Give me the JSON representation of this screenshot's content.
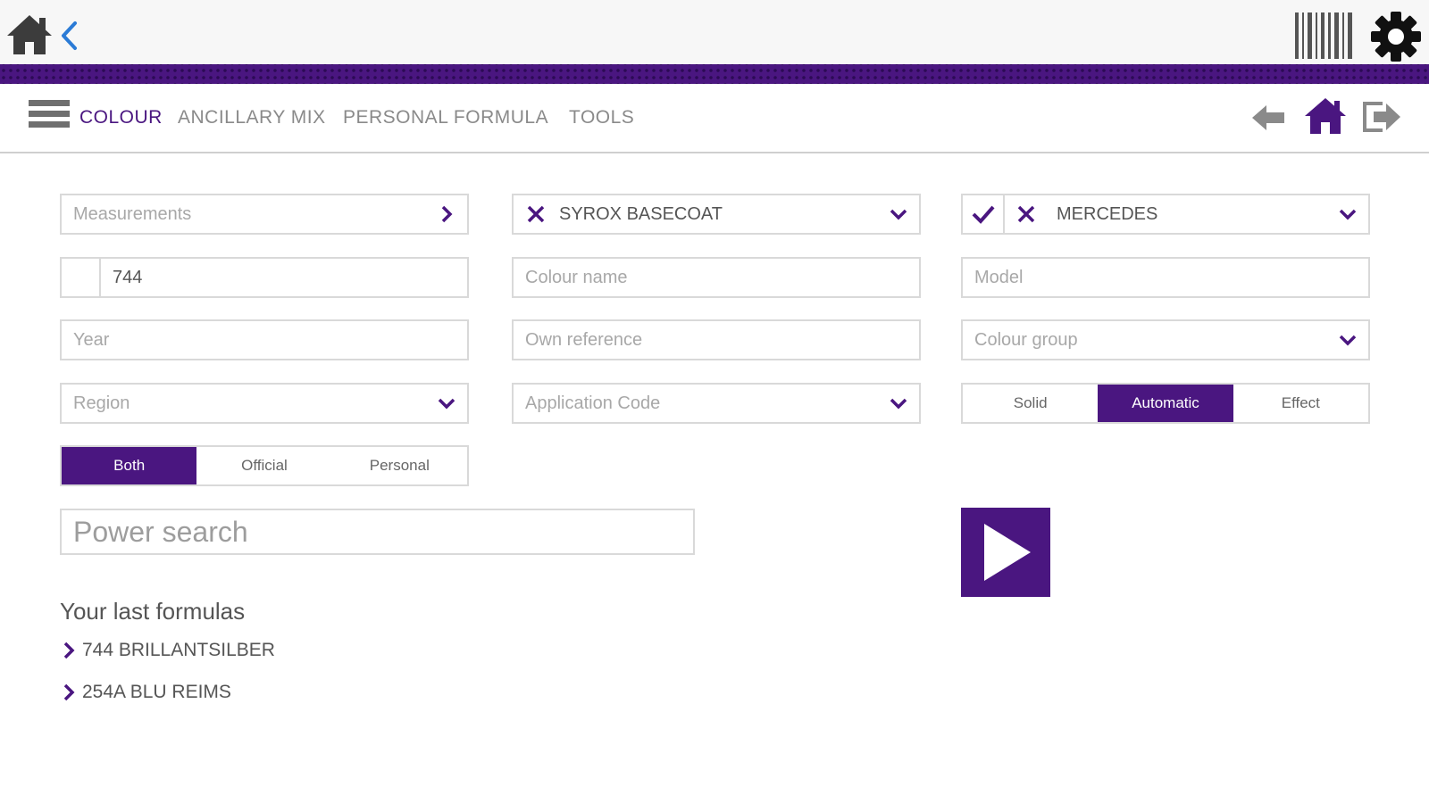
{
  "topbar": {
    "home_icon": "home-icon",
    "back_icon": "chevron-left-icon",
    "barcode_icon": "barcode-icon",
    "settings_icon": "gear-icon"
  },
  "nav": {
    "menu_icon": "hamburger-menu-icon",
    "tabs": [
      {
        "label": "COLOUR",
        "active": true
      },
      {
        "label": "ANCILLARY MIX",
        "active": false
      },
      {
        "label": "PERSONAL FORMULA",
        "active": false
      },
      {
        "label": "TOOLS",
        "active": false
      }
    ],
    "right_icons": [
      "arrow-left-icon",
      "home-icon",
      "logout-icon"
    ]
  },
  "form": {
    "measurements": {
      "placeholder": "Measurements"
    },
    "colour_code": {
      "value": "744"
    },
    "year": {
      "placeholder": "Year"
    },
    "region": {
      "placeholder": "Region"
    },
    "source_filter": {
      "options": [
        "Both",
        "Official",
        "Personal"
      ],
      "selected": "Both"
    },
    "product": {
      "value": "SYROX BASECOAT"
    },
    "colour_name": {
      "placeholder": "Colour name"
    },
    "own_reference": {
      "placeholder": "Own reference"
    },
    "application_code": {
      "placeholder": "Application Code"
    },
    "make": {
      "value": "MERCEDES"
    },
    "model": {
      "placeholder": "Model"
    },
    "colour_group": {
      "placeholder": "Colour group"
    },
    "finish_filter": {
      "options": [
        "Solid",
        "Automatic",
        "Effect"
      ],
      "selected": "Automatic"
    },
    "power_search": {
      "placeholder": "Power search"
    }
  },
  "last_formulas": {
    "title": "Your last formulas",
    "items": [
      "744 BRILLANTSILBER",
      "254A BLU REIMS"
    ]
  },
  "colors": {
    "accent": "#4a1680",
    "border": "#d9d9d9",
    "text": "#555555",
    "placeholder": "#a8a8a8"
  }
}
